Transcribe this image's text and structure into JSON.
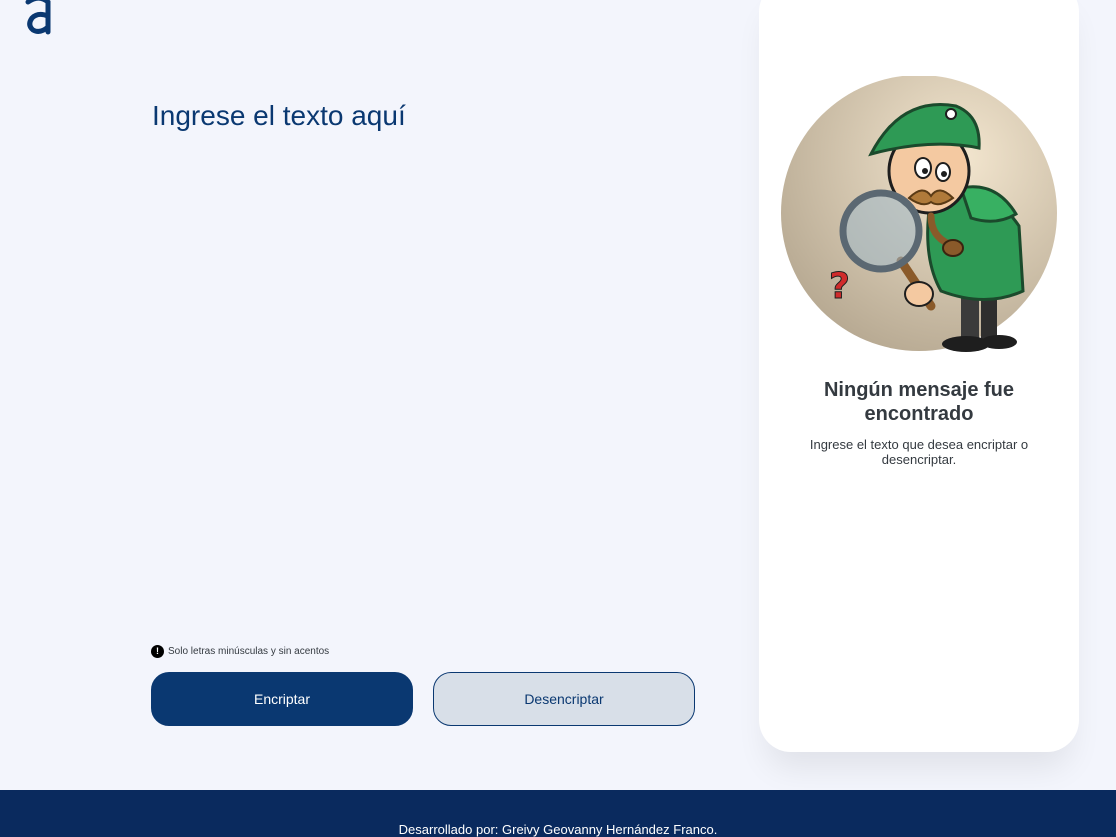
{
  "logo": {
    "icon": "alura-logo-icon",
    "color": "#0a3871"
  },
  "input": {
    "placeholder": "Ingrese el texto aquí",
    "value": ""
  },
  "hint": {
    "icon": "exclamation-circle-icon",
    "text": "Solo letras minúsculas y sin acentos"
  },
  "buttons": {
    "encrypt_label": "Encriptar",
    "decrypt_label": "Desencriptar"
  },
  "output_panel": {
    "illustration": "detective-magnifying-glass-illustration",
    "title": "Ningún mensaje fue encontrado",
    "text": "Ingrese el texto que desea encriptar o desencriptar."
  },
  "footer": {
    "text": "Desarrollado por: Greivy Geovanny Hernández Franco."
  },
  "colors": {
    "primary": "#0a3871",
    "background": "#f3f5fc",
    "footer": "#0a2a5e",
    "secondary_button": "#d8dfe8"
  }
}
